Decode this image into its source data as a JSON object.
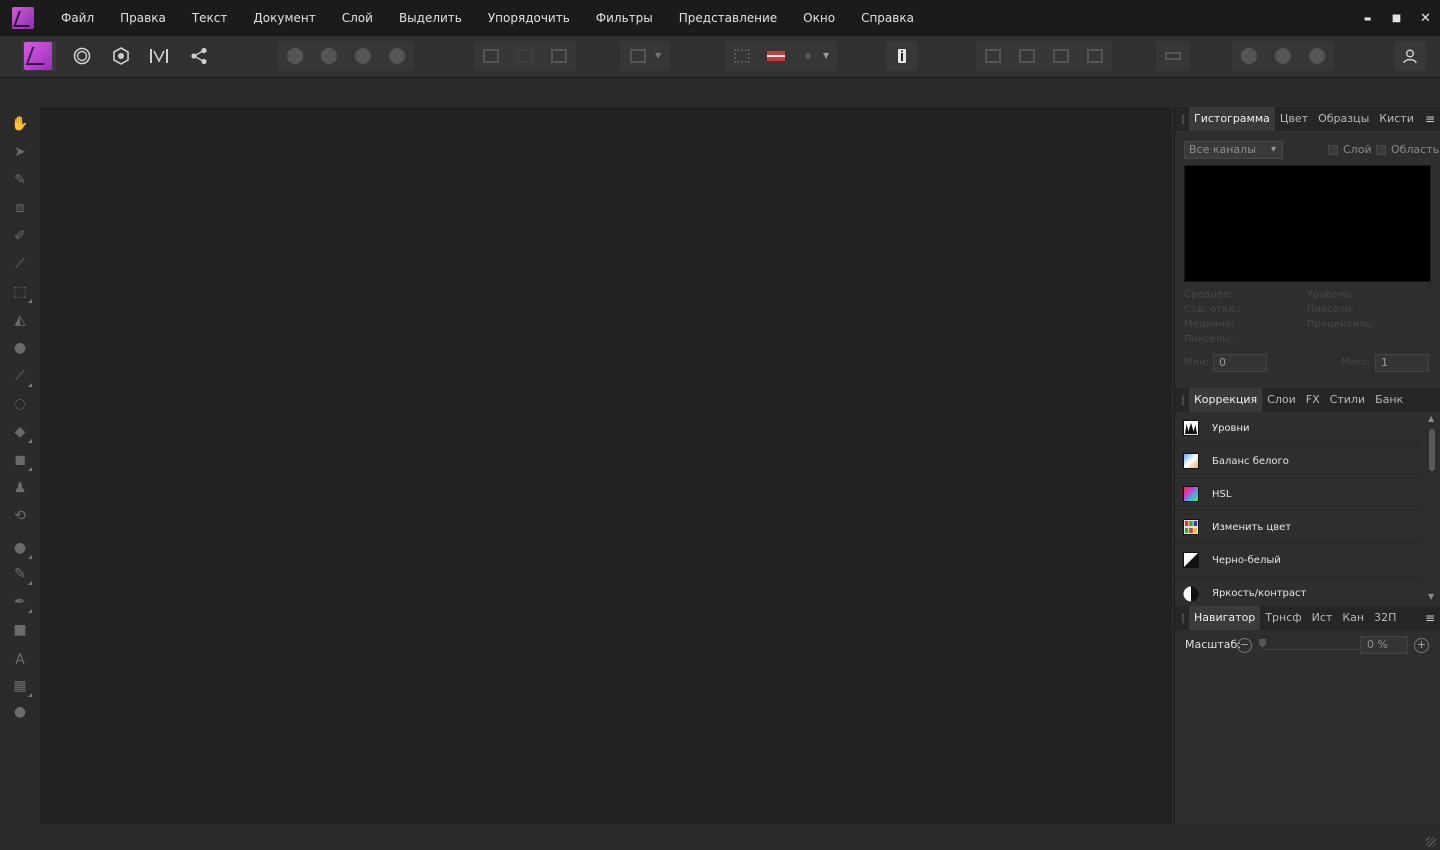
{
  "menu": {
    "items": [
      "Файл",
      "Правка",
      "Текст",
      "Документ",
      "Слой",
      "Выделить",
      "Упорядочить",
      "Фильтры",
      "Представление",
      "Окно",
      "Справка"
    ]
  },
  "window": {
    "minimize": "▬",
    "maximize": "■",
    "close": "✕"
  },
  "colors": {
    "accent": "#c94fd3",
    "panel_bg": "#2e2e2e",
    "canvas_bg": "#222222"
  },
  "histogram_panel": {
    "tabs": [
      "Гистограмма",
      "Цвет",
      "Образцы",
      "Кисти"
    ],
    "channel": "Все каналы",
    "checkbox_layer": "Слой",
    "checkbox_area": "Область",
    "stats_left": [
      "Среднее: -",
      "Стд. откл.: -",
      "Медиана: -",
      "Пикселы: -"
    ],
    "stats_right": [
      "Уровень: -",
      "Пиксели: -",
      "Процентиль: -"
    ],
    "min_label": "Мин:",
    "min_value": "0",
    "max_label": "Макс:",
    "max_value": "1"
  },
  "adjustment_panel": {
    "tabs": [
      "Коррекция",
      "Слои",
      "FX",
      "Стили",
      "Банк"
    ],
    "items": [
      {
        "label": "Уровни",
        "icon": "levels-icon"
      },
      {
        "label": "Баланс белого",
        "icon": "white-balance-icon"
      },
      {
        "label": "HSL",
        "icon": "hsl-icon"
      },
      {
        "label": "Изменить цвет",
        "icon": "replace-color-icon"
      },
      {
        "label": "Черно-белый",
        "icon": "black-white-icon"
      },
      {
        "label": "Яркость/контраст",
        "icon": "brightness-contrast-icon"
      }
    ]
  },
  "navigator_panel": {
    "tabs": [
      "Навигатор",
      "Трнсф",
      "Ист",
      "Кан",
      "32П"
    ],
    "zoom_label": "Масштаб:",
    "zoom_value": "0 %"
  }
}
